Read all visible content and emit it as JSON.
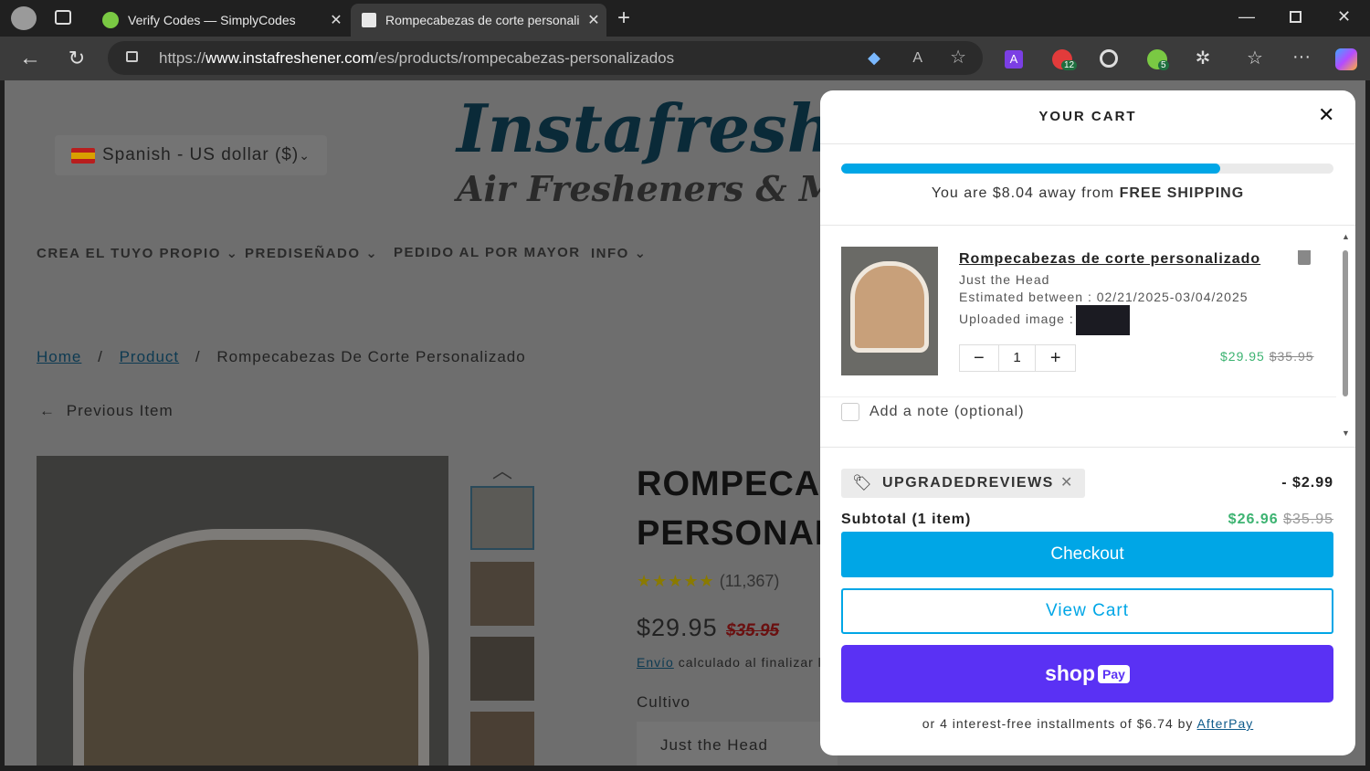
{
  "browser": {
    "tabs": [
      {
        "title": "Verify Codes — SimplyCodes"
      },
      {
        "title": "Rompecabezas de corte personali"
      }
    ],
    "url": {
      "prefix": "https://",
      "domain": "www.instafreshener.com",
      "path": "/es/products/rompecabezas-personalizados"
    },
    "badges": {
      "ext_red": "12",
      "ext_green": "5"
    }
  },
  "site": {
    "locale": "Spanish - US dollar ($)",
    "logo_main": "Instafreshener",
    "logo_sub": "Air Fresheners & More",
    "nav": [
      "CREA EL TUYO PROPIO",
      "PREDISEÑADO",
      "PEDIDO AL POR MAYOR",
      "INFO"
    ],
    "breadcrumb": {
      "home": "Home",
      "product": "Product",
      "current": "Rompecabezas De Corte Personalizado",
      "sep": "/"
    },
    "previous": "Previous Item",
    "product_title_1": "ROMPECABEZAS DE CORTE",
    "product_title_2": "PERSONALIZADO",
    "reviews": "(11,367)",
    "price": "$29.95",
    "compare_price": "$35.95",
    "shipping_link": "Envío",
    "shipping_text": "calculado al finalizar la compra",
    "option_label": "Cultivo",
    "option_value": "Just the Head"
  },
  "cart": {
    "title": "YOUR CART",
    "shipping_progress": 0.77,
    "shipping_msg": "You are $8.04 away from ",
    "shipping_bold": "FREE SHIPPING",
    "item": {
      "name": "Rompecabezas de corte personalizado",
      "variant": "Just the Head",
      "estimate": "Estimated between : 02/21/2025-03/04/2025",
      "uploaded": "Uploaded image :",
      "qty": "1",
      "price": "$29.95",
      "compare": "$35.95"
    },
    "note": "Add a note (optional)",
    "discount": {
      "code": "UPGRADEDREVIEWS",
      "amount": "- $2.99"
    },
    "subtotal_label": "Subtotal (1 item)",
    "subtotal": "$26.96",
    "subtotal_compare": "$35.95",
    "checkout": "Checkout",
    "view_cart": "View Cart",
    "shop": "shop",
    "pay": "Pay",
    "afterpay_text": "or 4 interest-free installments of $6.74 by ",
    "afterpay_link": "AfterPay"
  },
  "colors": {
    "accent": "#00a6e6",
    "shop_pay": "#5a31f4",
    "sale_green": "#3cb371"
  }
}
